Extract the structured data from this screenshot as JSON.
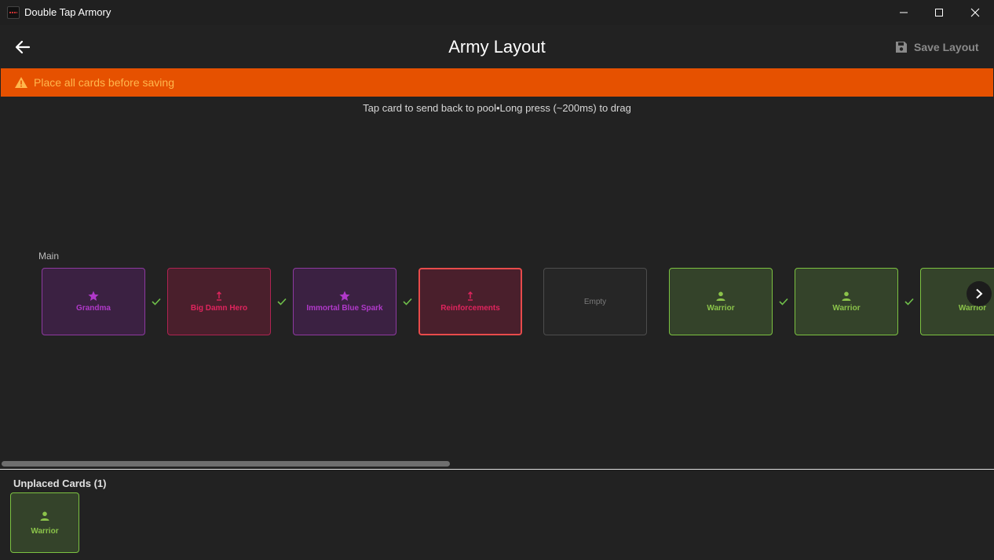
{
  "window": {
    "title": "Double Tap Armory"
  },
  "appbar": {
    "title": "Army Layout",
    "save_label": "Save Layout"
  },
  "banner": {
    "text": "Place all cards before saving"
  },
  "hint": "Tap card to send back to pool•Long press (~200ms) to drag",
  "lane": {
    "label": "Main",
    "slots": [
      {
        "label": "Grandma",
        "icon": "star-icon",
        "style": "purple",
        "placed": true
      },
      {
        "label": "Big Damn Hero",
        "icon": "upgrade-arrow-icon",
        "style": "pink",
        "placed": true
      },
      {
        "label": "Immortal Blue Spark",
        "icon": "star-icon",
        "style": "purple",
        "placed": true
      },
      {
        "label": "Reinforcements",
        "icon": "upgrade-arrow-icon",
        "style": "red-selected",
        "placed": false
      },
      {
        "label": "Empty",
        "icon": "",
        "style": "empty",
        "placed": false
      },
      {
        "label": "Warrior",
        "icon": "person-icon",
        "style": "green",
        "placed": true
      },
      {
        "label": "Warrior",
        "icon": "person-icon",
        "style": "green",
        "placed": true
      },
      {
        "label": "Warrior",
        "icon": "person-icon",
        "style": "green",
        "placed": false
      }
    ]
  },
  "pool": {
    "title": "Unplaced Cards (1)",
    "cards": [
      {
        "label": "Warrior",
        "icon": "person-icon"
      }
    ]
  },
  "colors": {
    "warning": "#e65100",
    "warning_text": "#ffb74d",
    "purple": "#b039c9",
    "pink": "#e0245e",
    "green": "#8bc34a",
    "check": "#6fbf4a"
  }
}
